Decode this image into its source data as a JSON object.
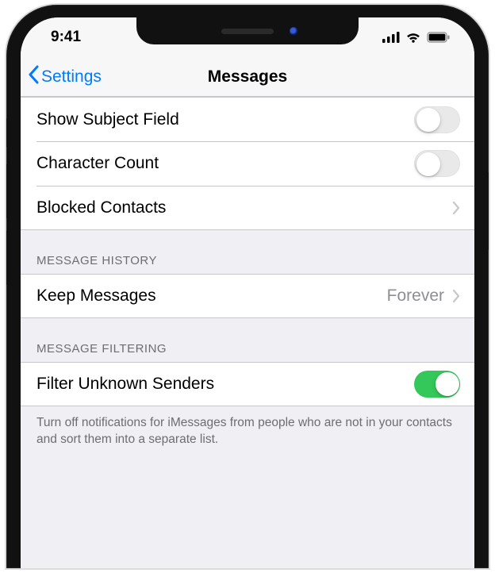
{
  "status": {
    "time": "9:41"
  },
  "nav": {
    "back_label": "Settings",
    "title": "Messages"
  },
  "section1": {
    "row_subject": "Show Subject Field",
    "row_charcount": "Character Count",
    "row_blocked": "Blocked Contacts"
  },
  "section2": {
    "header": "Message History",
    "row_keep": "Keep Messages",
    "row_keep_value": "Forever"
  },
  "section3": {
    "header": "Message Filtering",
    "row_filter": "Filter Unknown Senders",
    "footer": "Turn off notifications for iMessages from people who are not in your contacts and sort them into a separate list."
  }
}
